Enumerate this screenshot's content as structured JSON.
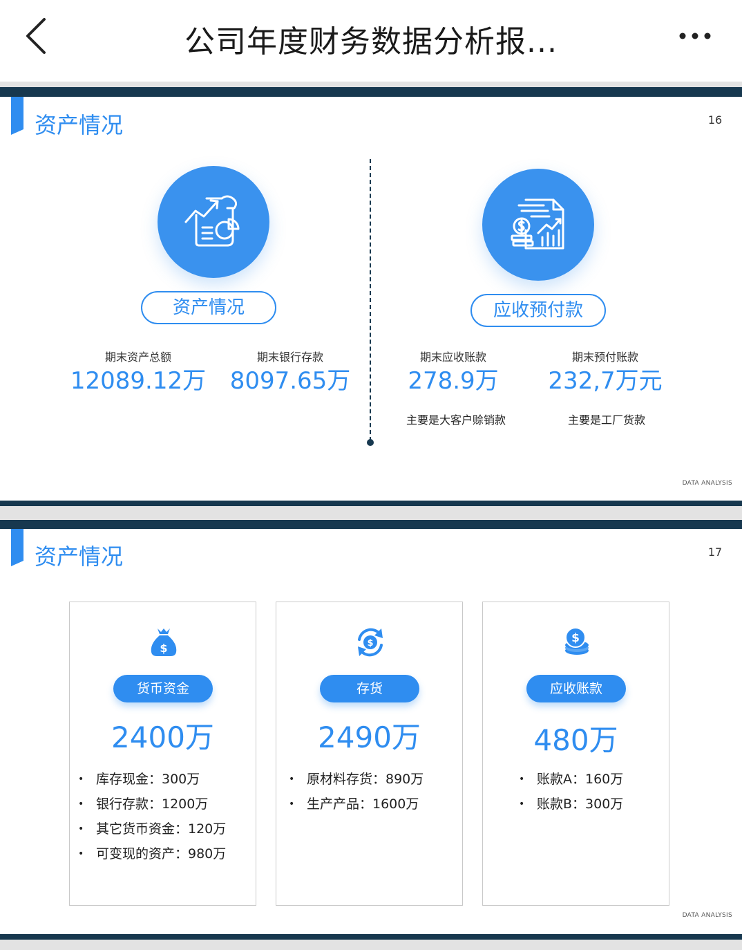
{
  "header": {
    "title": "公司年度财务数据分析报..."
  },
  "slide1": {
    "title": "资产情况",
    "page": "16",
    "footer": "DATA ANALYSIS",
    "left": {
      "pill": "资产情况",
      "icon": "report-chart-icon",
      "stats": [
        {
          "label": "期末资产总额",
          "value": "12089.12万"
        },
        {
          "label": "期末银行存款",
          "value": "8097.65万"
        }
      ]
    },
    "right": {
      "pill": "应收预付款",
      "icon": "finance-document-icon",
      "stats": [
        {
          "label": "期末应收账款",
          "value": "278.9万",
          "note": "主要是大客户赊销款"
        },
        {
          "label": "期末预付账款",
          "value": "232,7万元",
          "note": "主要是工厂货款"
        }
      ]
    }
  },
  "slide2": {
    "title": "资产情况",
    "page": "17",
    "footer": "DATA ANALYSIS",
    "cards": [
      {
        "icon": "money-bag-icon",
        "label": "货币资金",
        "value": "2400万",
        "items": [
          "库存现金：300万",
          "银行存款：1200万",
          "其它货币资金：120万",
          "可变现的资产：980万"
        ]
      },
      {
        "icon": "dollar-cycle-icon",
        "label": "存货",
        "value": "2490万",
        "items": [
          "原材料存货：890万",
          "生产产品：1600万"
        ]
      },
      {
        "icon": "coin-stack-icon",
        "label": "应收账款",
        "value": "480万",
        "items": [
          "账款A：160万",
          "账款B：300万"
        ]
      }
    ]
  },
  "colors": {
    "accent": "#2f8df0",
    "navy": "#17384f",
    "gap": "#e3e3e3"
  }
}
